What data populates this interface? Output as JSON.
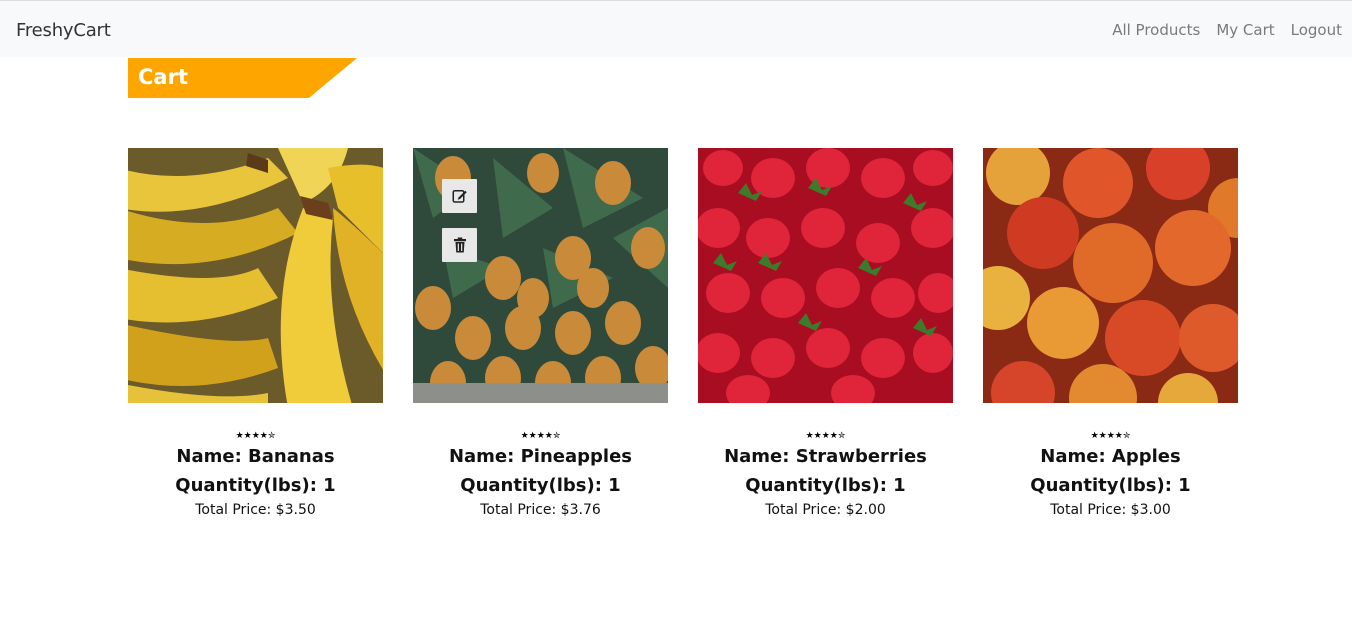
{
  "nav": {
    "brand": "FreshyCart",
    "links": [
      "All Products",
      "My Cart",
      "Logout"
    ]
  },
  "page": {
    "title": "Cart"
  },
  "colors": {
    "accent": "#ffa500",
    "navbar_bg": "#f8f9fa"
  },
  "products": [
    {
      "name": "Name: Bananas",
      "quantity": "Quantity(lbs): 1",
      "price": "Total Price: $3.50",
      "rating": "★★★★✮",
      "image": "bananas"
    },
    {
      "name": "Name: Pineapples",
      "quantity": "Quantity(lbs): 1",
      "price": "Total Price: $3.76",
      "rating": "★★★★✮",
      "image": "pineapples"
    },
    {
      "name": "Name: Strawberries",
      "quantity": "Quantity(lbs): 1",
      "price": "Total Price: $2.00",
      "rating": "★★★★✮",
      "image": "strawberries"
    },
    {
      "name": "Name: Apples",
      "quantity": "Quantity(lbs): 1",
      "price": "Total Price: $3.00",
      "rating": "★★★★✮",
      "image": "apples"
    }
  ],
  "icons": {
    "edit": "edit-icon",
    "delete": "trash-icon"
  }
}
